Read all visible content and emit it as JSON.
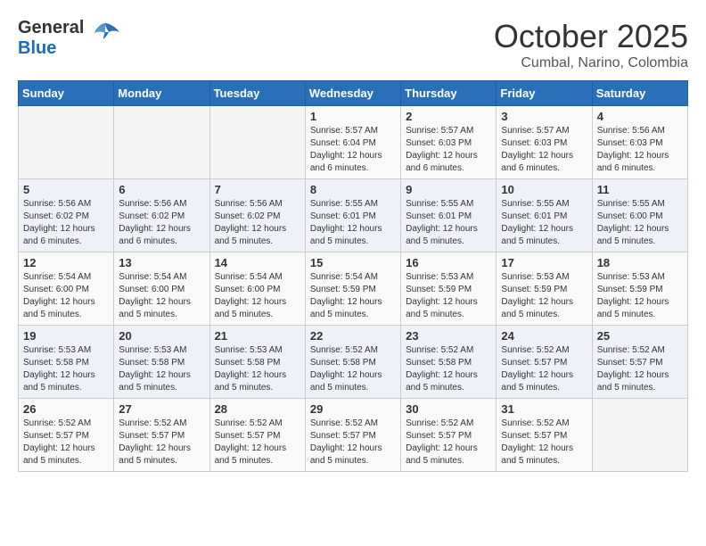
{
  "header": {
    "logo_general": "General",
    "logo_blue": "Blue",
    "month": "October 2025",
    "location": "Cumbal, Narino, Colombia"
  },
  "days_of_week": [
    "Sunday",
    "Monday",
    "Tuesday",
    "Wednesday",
    "Thursday",
    "Friday",
    "Saturday"
  ],
  "weeks": [
    [
      {
        "day": "",
        "info": ""
      },
      {
        "day": "",
        "info": ""
      },
      {
        "day": "",
        "info": ""
      },
      {
        "day": "1",
        "info": "Sunrise: 5:57 AM\nSunset: 6:04 PM\nDaylight: 12 hours\nand 6 minutes."
      },
      {
        "day": "2",
        "info": "Sunrise: 5:57 AM\nSunset: 6:03 PM\nDaylight: 12 hours\nand 6 minutes."
      },
      {
        "day": "3",
        "info": "Sunrise: 5:57 AM\nSunset: 6:03 PM\nDaylight: 12 hours\nand 6 minutes."
      },
      {
        "day": "4",
        "info": "Sunrise: 5:56 AM\nSunset: 6:03 PM\nDaylight: 12 hours\nand 6 minutes."
      }
    ],
    [
      {
        "day": "5",
        "info": "Sunrise: 5:56 AM\nSunset: 6:02 PM\nDaylight: 12 hours\nand 6 minutes."
      },
      {
        "day": "6",
        "info": "Sunrise: 5:56 AM\nSunset: 6:02 PM\nDaylight: 12 hours\nand 6 minutes."
      },
      {
        "day": "7",
        "info": "Sunrise: 5:56 AM\nSunset: 6:02 PM\nDaylight: 12 hours\nand 5 minutes."
      },
      {
        "day": "8",
        "info": "Sunrise: 5:55 AM\nSunset: 6:01 PM\nDaylight: 12 hours\nand 5 minutes."
      },
      {
        "day": "9",
        "info": "Sunrise: 5:55 AM\nSunset: 6:01 PM\nDaylight: 12 hours\nand 5 minutes."
      },
      {
        "day": "10",
        "info": "Sunrise: 5:55 AM\nSunset: 6:01 PM\nDaylight: 12 hours\nand 5 minutes."
      },
      {
        "day": "11",
        "info": "Sunrise: 5:55 AM\nSunset: 6:00 PM\nDaylight: 12 hours\nand 5 minutes."
      }
    ],
    [
      {
        "day": "12",
        "info": "Sunrise: 5:54 AM\nSunset: 6:00 PM\nDaylight: 12 hours\nand 5 minutes."
      },
      {
        "day": "13",
        "info": "Sunrise: 5:54 AM\nSunset: 6:00 PM\nDaylight: 12 hours\nand 5 minutes."
      },
      {
        "day": "14",
        "info": "Sunrise: 5:54 AM\nSunset: 6:00 PM\nDaylight: 12 hours\nand 5 minutes."
      },
      {
        "day": "15",
        "info": "Sunrise: 5:54 AM\nSunset: 5:59 PM\nDaylight: 12 hours\nand 5 minutes."
      },
      {
        "day": "16",
        "info": "Sunrise: 5:53 AM\nSunset: 5:59 PM\nDaylight: 12 hours\nand 5 minutes."
      },
      {
        "day": "17",
        "info": "Sunrise: 5:53 AM\nSunset: 5:59 PM\nDaylight: 12 hours\nand 5 minutes."
      },
      {
        "day": "18",
        "info": "Sunrise: 5:53 AM\nSunset: 5:59 PM\nDaylight: 12 hours\nand 5 minutes."
      }
    ],
    [
      {
        "day": "19",
        "info": "Sunrise: 5:53 AM\nSunset: 5:58 PM\nDaylight: 12 hours\nand 5 minutes."
      },
      {
        "day": "20",
        "info": "Sunrise: 5:53 AM\nSunset: 5:58 PM\nDaylight: 12 hours\nand 5 minutes."
      },
      {
        "day": "21",
        "info": "Sunrise: 5:53 AM\nSunset: 5:58 PM\nDaylight: 12 hours\nand 5 minutes."
      },
      {
        "day": "22",
        "info": "Sunrise: 5:52 AM\nSunset: 5:58 PM\nDaylight: 12 hours\nand 5 minutes."
      },
      {
        "day": "23",
        "info": "Sunrise: 5:52 AM\nSunset: 5:58 PM\nDaylight: 12 hours\nand 5 minutes."
      },
      {
        "day": "24",
        "info": "Sunrise: 5:52 AM\nSunset: 5:57 PM\nDaylight: 12 hours\nand 5 minutes."
      },
      {
        "day": "25",
        "info": "Sunrise: 5:52 AM\nSunset: 5:57 PM\nDaylight: 12 hours\nand 5 minutes."
      }
    ],
    [
      {
        "day": "26",
        "info": "Sunrise: 5:52 AM\nSunset: 5:57 PM\nDaylight: 12 hours\nand 5 minutes."
      },
      {
        "day": "27",
        "info": "Sunrise: 5:52 AM\nSunset: 5:57 PM\nDaylight: 12 hours\nand 5 minutes."
      },
      {
        "day": "28",
        "info": "Sunrise: 5:52 AM\nSunset: 5:57 PM\nDaylight: 12 hours\nand 5 minutes."
      },
      {
        "day": "29",
        "info": "Sunrise: 5:52 AM\nSunset: 5:57 PM\nDaylight: 12 hours\nand 5 minutes."
      },
      {
        "day": "30",
        "info": "Sunrise: 5:52 AM\nSunset: 5:57 PM\nDaylight: 12 hours\nand 5 minutes."
      },
      {
        "day": "31",
        "info": "Sunrise: 5:52 AM\nSunset: 5:57 PM\nDaylight: 12 hours\nand 5 minutes."
      },
      {
        "day": "",
        "info": ""
      }
    ]
  ]
}
